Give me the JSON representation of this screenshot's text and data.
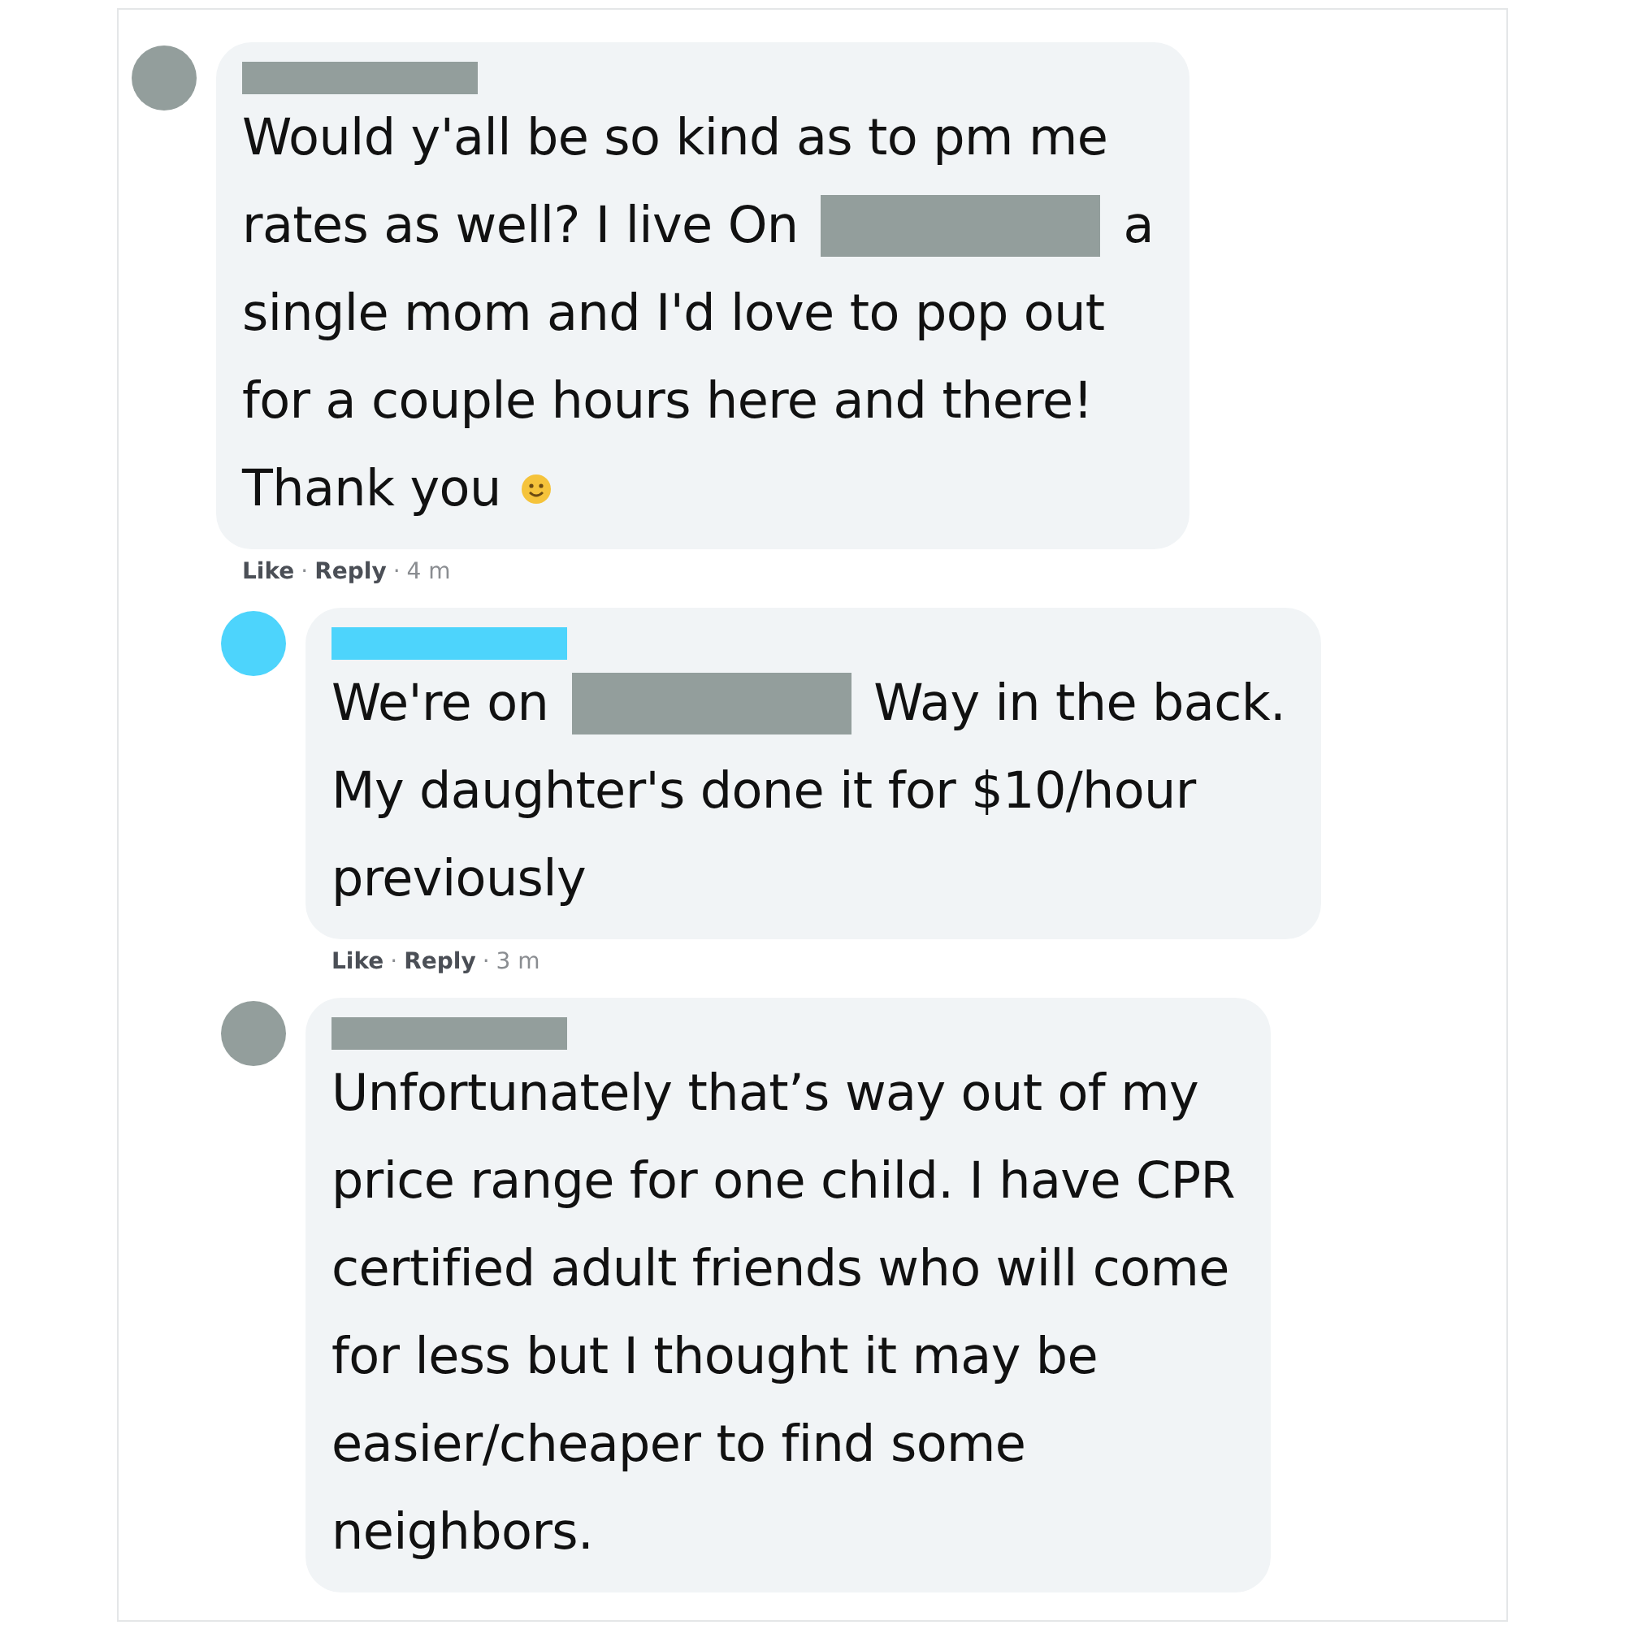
{
  "comments": [
    {
      "color": "#939e9c",
      "indent": false,
      "lines": [
        [
          {
            "kind": "text",
            "text": "Would y'all be so kind as to pm me"
          }
        ],
        [
          {
            "kind": "text",
            "text": "rates as well? I live On"
          },
          {
            "kind": "redaction"
          },
          {
            "kind": "text",
            "text": "a"
          }
        ],
        [
          {
            "kind": "text",
            "text": "single mom and I'd love to pop out"
          }
        ],
        [
          {
            "kind": "text",
            "text": "for a couple hours here and there!"
          }
        ],
        [
          {
            "kind": "text",
            "text": "Thank you"
          },
          {
            "kind": "emoji"
          }
        ]
      ],
      "actions": [
        "Like",
        "Reply"
      ],
      "separator": "·",
      "time": "4 m"
    },
    {
      "color": "#4dd4fc",
      "indent": true,
      "lines": [
        [
          {
            "kind": "text",
            "text": "We're on"
          },
          {
            "kind": "redaction"
          },
          {
            "kind": "text",
            "text": "Way in the back."
          }
        ],
        [
          {
            "kind": "text",
            "text": "My daughter's done it for $10/hour"
          }
        ],
        [
          {
            "kind": "text",
            "text": "previously"
          }
        ]
      ],
      "actions": [
        "Like",
        "Reply"
      ],
      "separator": "·",
      "time": "3 m"
    },
    {
      "color": "#939e9c",
      "indent": true,
      "lines": [
        [
          {
            "kind": "text",
            "text": "Unfortunately that’s way out of my"
          }
        ],
        [
          {
            "kind": "text",
            "text": "price range for one child. I have CPR"
          }
        ],
        [
          {
            "kind": "text",
            "text": "certified adult friends who will come"
          }
        ],
        [
          {
            "kind": "text",
            "text": "for less but I thought it may be"
          }
        ],
        [
          {
            "kind": "text",
            "text": "easier/cheaper to find some"
          }
        ],
        [
          {
            "kind": "text",
            "text": "neighbors."
          }
        ]
      ]
    }
  ]
}
